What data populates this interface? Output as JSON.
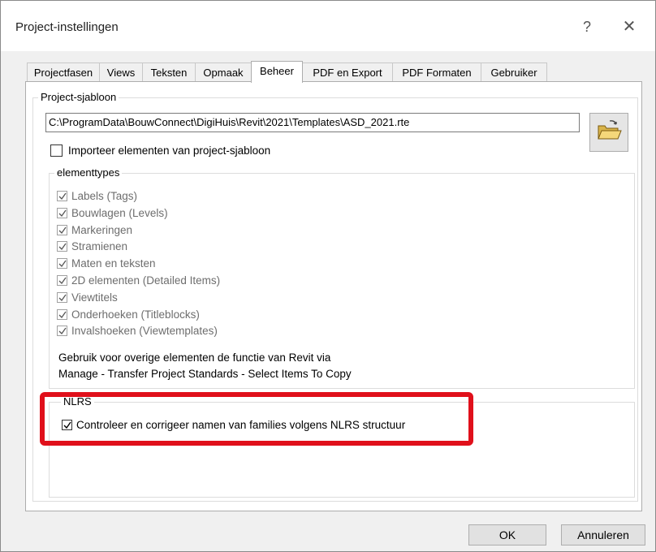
{
  "window": {
    "title": "Project-instellingen",
    "help_glyph": "?",
    "close_glyph": "✕"
  },
  "tabs": [
    {
      "label": "Projectfasen",
      "active": false
    },
    {
      "label": "Views",
      "active": false
    },
    {
      "label": "Teksten",
      "active": false
    },
    {
      "label": "Opmaak",
      "active": false
    },
    {
      "label": "Beheer",
      "active": true
    },
    {
      "label": "PDF en Export",
      "active": false
    },
    {
      "label": "PDF Formaten",
      "active": false
    },
    {
      "label": "Gebruiker",
      "active": false
    }
  ],
  "template_group": {
    "legend": "Project-sjabloon",
    "path": "C:\\ProgramData\\BouwConnect\\DigiHuis\\Revit\\2021\\Templates\\ASD_2021.rte",
    "import_label": "Importeer elementen van project-sjabloon",
    "import_checked": false
  },
  "elementtypes": {
    "legend": "elementtypes",
    "items": [
      {
        "label": "Labels (Tags)",
        "checked": true
      },
      {
        "label": "Bouwlagen (Levels)",
        "checked": true
      },
      {
        "label": "Markeringen",
        "checked": true
      },
      {
        "label": "Stramienen",
        "checked": true
      },
      {
        "label": "Maten en teksten",
        "checked": true
      },
      {
        "label": "2D elementen (Detailed Items)",
        "checked": true
      },
      {
        "label": "Viewtitels",
        "checked": true
      },
      {
        "label": "Onderhoeken (Titleblocks)",
        "checked": true
      },
      {
        "label": "Invalshoeken (Viewtemplates)",
        "checked": true
      }
    ],
    "note_line1": "Gebruik voor overige elementen de functie van Revit via",
    "note_line2": "Manage - Transfer Project Standards - Select Items To Copy"
  },
  "nlrs": {
    "legend": "NLRS",
    "check_label": "Controleer en corrigeer namen van families volgens NLRS structuur",
    "checked": true
  },
  "buttons": {
    "ok": "OK",
    "cancel": "Annuleren"
  },
  "colors": {
    "highlight": "#e0101b"
  }
}
